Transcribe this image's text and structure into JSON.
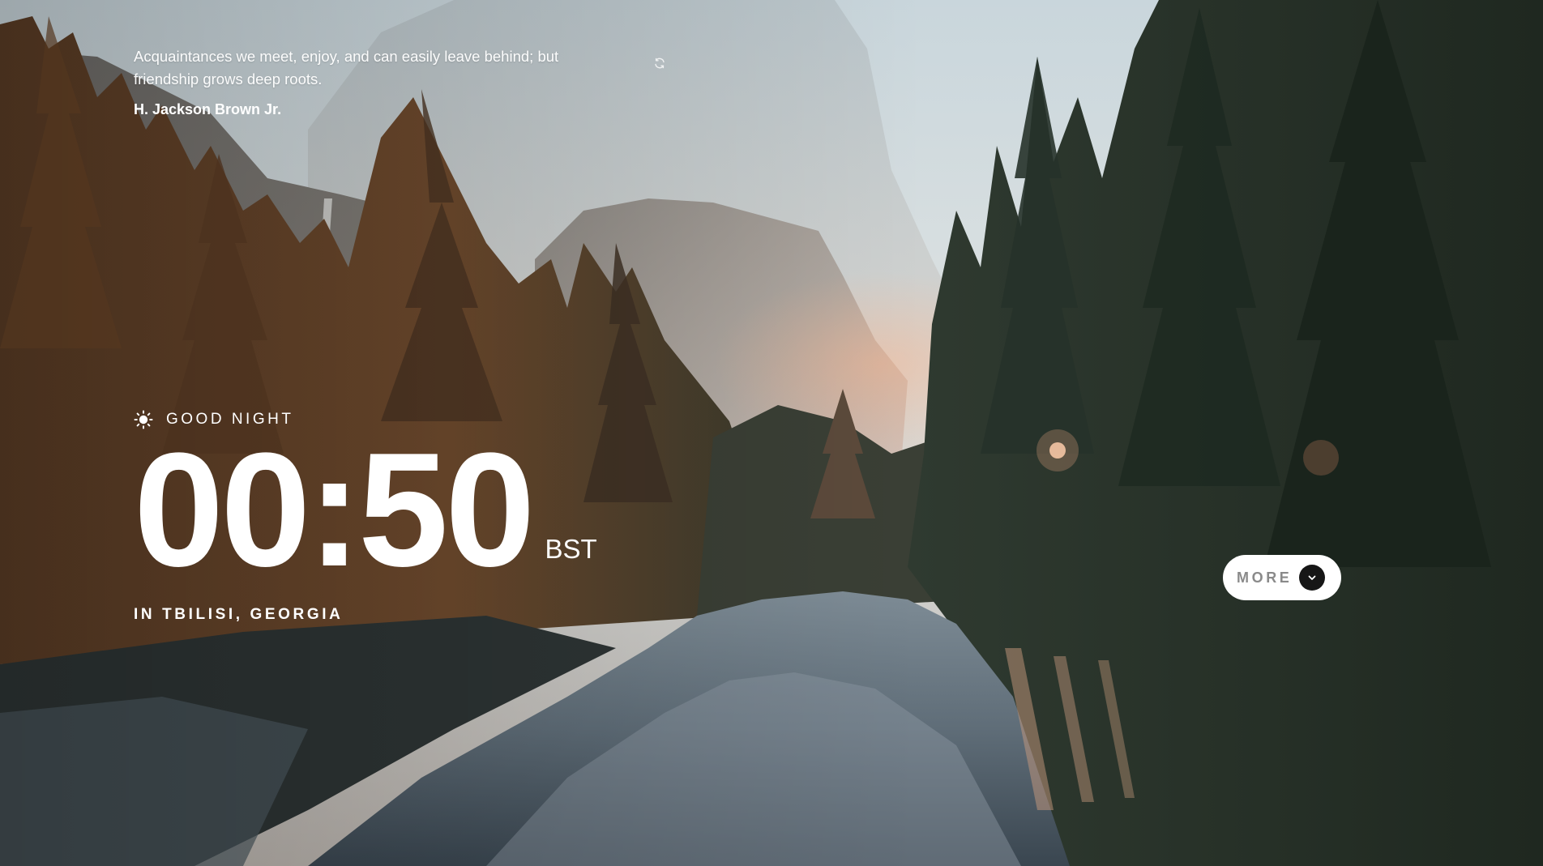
{
  "quote": {
    "text": "Acquaintances we meet, enjoy, and can easily leave behind; but friendship grows deep roots.",
    "author": "H. Jackson Brown Jr.",
    "refresh_icon": "refresh-icon"
  },
  "clock": {
    "greeting_icon": "sun-icon",
    "greeting": "GOOD NIGHT",
    "time": "00:50",
    "timezone": "BST",
    "location": "IN TBILISI, GEORGIA"
  },
  "more_button": {
    "label": "MORE",
    "icon": "chevron-down-icon"
  },
  "colors": {
    "text": "#ffffff",
    "button_bg": "#ffffff",
    "button_label": "#8a8a8a",
    "chevron_bg": "#161616"
  }
}
